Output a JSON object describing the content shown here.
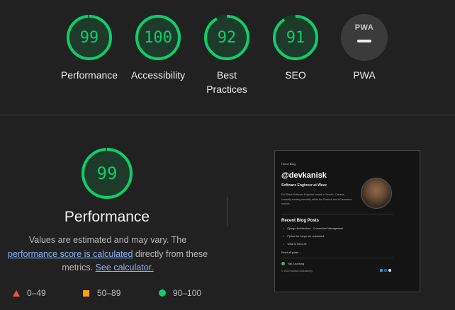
{
  "summary": {
    "categories": [
      {
        "label": "Performance",
        "score": "99"
      },
      {
        "label": "Accessibility",
        "score": "100"
      },
      {
        "label": "Best Practices",
        "score": "92"
      },
      {
        "label": "SEO",
        "score": "91"
      },
      {
        "label": "PWA",
        "score": "",
        "badge": "PWA"
      }
    ]
  },
  "detail": {
    "score": "99",
    "title": "Performance",
    "note_prefix": "Values are estimated and may vary. The ",
    "note_link1": "performance score is calculated",
    "note_mid": " directly from these metrics. ",
    "note_link2": "See calculator.",
    "legend": [
      {
        "range": "0–49",
        "icon": "red-triangle-icon"
      },
      {
        "range": "50–89",
        "icon": "orange-square-icon"
      },
      {
        "range": "90–100",
        "icon": "green-circle-icon"
      }
    ]
  },
  "screenshot": {
    "crumbs": "Home   Blog",
    "handle": "@devkanisk",
    "role": "Software Engineer at Wave",
    "bio": "Full Stack Software Engineer based in Toronto, Canada, currently working remotely within the Finance and eCommerce sectors.",
    "posts_heading": "Recent Blog Posts",
    "posts": [
      "Django Architecture - Connection Management",
      "Python for loops are redundant",
      "What is Next.JS"
    ],
    "read_all": "Read all posts  →",
    "learning": "Yall, Learning",
    "copyright": "© 2023 Kanisk Chakraborty"
  },
  "colors": {
    "pass": "#0cce6b",
    "average": "#ffa400",
    "fail": "#ff4e42"
  }
}
